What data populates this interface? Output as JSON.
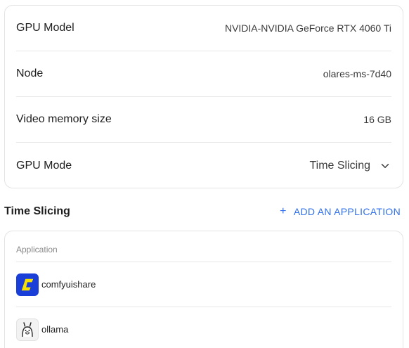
{
  "gpu_info": {
    "rows": [
      {
        "label": "GPU Model",
        "value": "NVIDIA-NVIDIA GeForce RTX 4060 Ti"
      },
      {
        "label": "Node",
        "value": "olares-ms-7d40"
      },
      {
        "label": "Video memory size",
        "value": "16 GB"
      }
    ],
    "mode": {
      "label": "GPU Mode",
      "value": "Time Slicing",
      "icon": "chevron-down-icon"
    }
  },
  "time_slicing": {
    "title": "Time Slicing",
    "add_button": {
      "label": "ADD AN APPLICATION",
      "icon": "plus-icon"
    },
    "table": {
      "header": "Application",
      "apps": [
        {
          "name": "comfyuishare",
          "icon": "comfyui-icon",
          "icon_color": "#1a3fd9"
        },
        {
          "name": "ollama",
          "icon": "ollama-icon",
          "icon_color": "#f2f2f2"
        }
      ]
    }
  },
  "colors": {
    "accent": "#2f6fed",
    "border": "#e3e3e3"
  }
}
